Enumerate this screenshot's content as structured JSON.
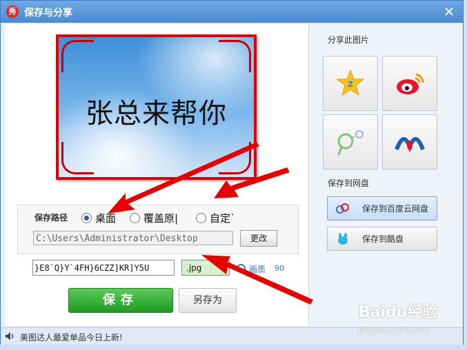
{
  "window": {
    "title": "保存与分享",
    "app_icon_glyph": "秀"
  },
  "preview": {
    "text": "张总来帮你",
    "frame_color": "#e20000"
  },
  "save_path": {
    "label": "保存路径",
    "options": [
      {
        "label": "桌面",
        "selected": true
      },
      {
        "label": "覆盖原|",
        "selected": false
      },
      {
        "label": "自定`",
        "selected": false
      }
    ],
    "path_value": "C:\\Users\\Administrator\\Desktop",
    "change_label": "更改"
  },
  "file": {
    "name_value": "}E8`Q}Y`4FH}6CZZ]KR]Y5U",
    "format_value": ".jpg",
    "quality_label": "画质",
    "quality_value": "90"
  },
  "actions": {
    "save_label": "保存",
    "save_as_label": "另存为"
  },
  "share": {
    "title": "分享此图片",
    "buttons": [
      {
        "name": "qzone-icon"
      },
      {
        "name": "weibo-icon"
      },
      {
        "name": "pengyou-icon"
      },
      {
        "name": "renren-icon"
      }
    ]
  },
  "netdisk": {
    "title": "保存到网盘",
    "baidu_label": "保存到百度云网盘",
    "kupan_label": "保存到酷盘"
  },
  "status": {
    "text": "美图达人最爱单品今日上新!"
  },
  "watermark": {
    "brand": "Baidu经验",
    "url": "jingyan.baidu.com"
  },
  "colors": {
    "accent": "#4d8ad2",
    "save_green": "#1f9b21",
    "arrow_red": "#e60000"
  }
}
